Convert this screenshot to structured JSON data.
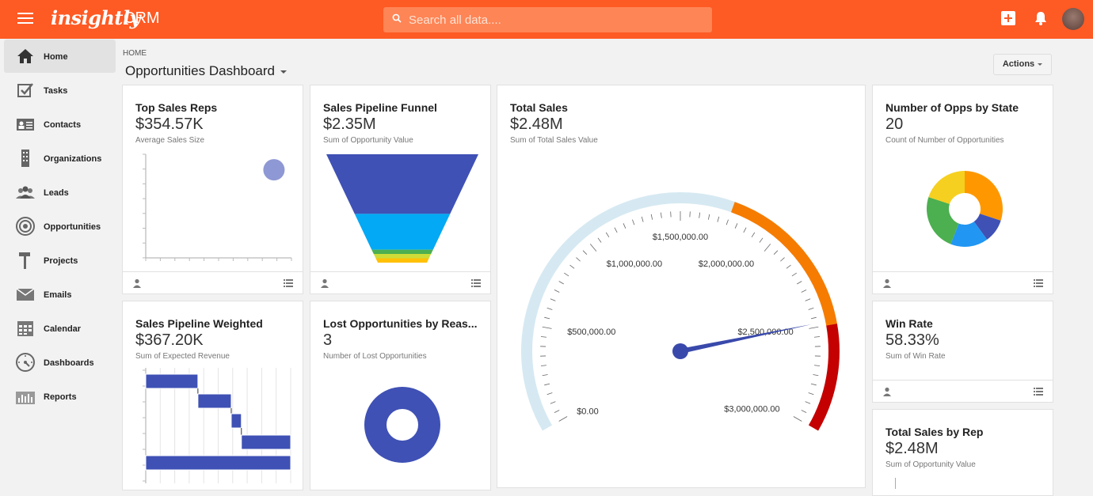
{
  "header": {
    "logo": "insightly",
    "app_name": "CRM",
    "search_placeholder": "Search all data....",
    "brand_color": "#fe5a24"
  },
  "sidebar": {
    "items": [
      {
        "label": "Home",
        "icon": "home-icon",
        "active": true
      },
      {
        "label": "Tasks",
        "icon": "checkbox-icon"
      },
      {
        "label": "Contacts",
        "icon": "contact-card-icon"
      },
      {
        "label": "Organizations",
        "icon": "building-icon"
      },
      {
        "label": "Leads",
        "icon": "people-icon"
      },
      {
        "label": "Opportunities",
        "icon": "target-icon"
      },
      {
        "label": "Projects",
        "icon": "hammer-icon"
      },
      {
        "label": "Emails",
        "icon": "envelope-icon"
      },
      {
        "label": "Calendar",
        "icon": "calendar-icon"
      },
      {
        "label": "Dashboards",
        "icon": "gauge-icon"
      },
      {
        "label": "Reports",
        "icon": "bar-chart-icon"
      }
    ]
  },
  "page": {
    "breadcrumb": "HOME",
    "title": "Opportunities Dashboard",
    "actions_label": "Actions"
  },
  "cards": {
    "top_sales_reps": {
      "title": "Top Sales Reps",
      "value": "$354.57K",
      "subtitle": "Average Sales Size"
    },
    "pipeline_funnel": {
      "title": "Sales Pipeline Funnel",
      "value": "$2.35M",
      "subtitle": "Sum of Opportunity Value"
    },
    "total_sales": {
      "title": "Total Sales",
      "value": "$2.48M",
      "subtitle": "Sum of Total Sales Value"
    },
    "opps_by_state": {
      "title": "Number of Opps by State",
      "value": "20",
      "subtitle": "Count of Number of Opportunities"
    },
    "pipeline_weighted": {
      "title": "Sales Pipeline Weighted",
      "value": "$367.20K",
      "subtitle": "Sum of Expected Revenue"
    },
    "lost_opps": {
      "title": "Lost Opportunities by Reas...",
      "value": "3",
      "subtitle": "Number of Lost Opportunities"
    },
    "win_rate": {
      "title": "Win Rate",
      "value": "58.33%",
      "subtitle": "Sum of Win Rate"
    },
    "sales_by_rep": {
      "title": "Total Sales by Rep",
      "value": "$2.48M",
      "subtitle": "Sum of Opportunity Value"
    }
  },
  "chart_data": [
    {
      "type": "scatter",
      "points": [
        {
          "x": 0.88,
          "y": 0.85
        }
      ],
      "color": "#8e98d4"
    },
    {
      "type": "bar",
      "subtype": "funnel",
      "stages": [
        {
          "value": 0.55,
          "color": "#3f51b5"
        },
        {
          "value": 0.33,
          "color": "#03a9f4"
        },
        {
          "value": 0.04,
          "color": "#4caf50"
        },
        {
          "value": 0.04,
          "color": "#cddc39"
        },
        {
          "value": 0.04,
          "color": "#ffc107"
        }
      ]
    },
    {
      "type": "gauge",
      "min": 0,
      "max": 3000000,
      "value": 2480000,
      "tick_labels": [
        "$0.00",
        "$500,000.00",
        "$1,000,000.00",
        "$1,500,000.00",
        "$2,000,000.00",
        "$2,500,000.00",
        "$3,000,000.00"
      ],
      "bands": [
        {
          "from": 0,
          "to": 1750000,
          "color": "#d6e9f2"
        },
        {
          "from": 1750000,
          "to": 2500000,
          "color": "#f57c00"
        },
        {
          "from": 2500000,
          "to": 3000000,
          "color": "#c40000"
        }
      ],
      "needle_color": "#3949ab"
    },
    {
      "type": "pie",
      "donut": true,
      "slices": [
        {
          "value": 0.3,
          "color": "#ff9800"
        },
        {
          "value": 0.1,
          "color": "#3f51b5"
        },
        {
          "value": 0.16,
          "color": "#2196f3"
        },
        {
          "value": 0.24,
          "color": "#4caf50"
        },
        {
          "value": 0.2,
          "color": "#f5d020"
        }
      ]
    },
    {
      "type": "bar",
      "subtype": "waterfall",
      "steps": [
        {
          "start": 0.0,
          "end": 0.36
        },
        {
          "start": 0.36,
          "end": 0.59
        },
        {
          "start": 0.59,
          "end": 0.66
        },
        {
          "start": 0.66,
          "end": 1.0
        },
        {
          "start": 0.0,
          "end": 1.0,
          "total": true
        }
      ],
      "color": "#3f51b5"
    },
    {
      "type": "pie",
      "donut": true,
      "slices": [
        {
          "value": 1.0,
          "color": "#3f51b5"
        }
      ]
    }
  ]
}
